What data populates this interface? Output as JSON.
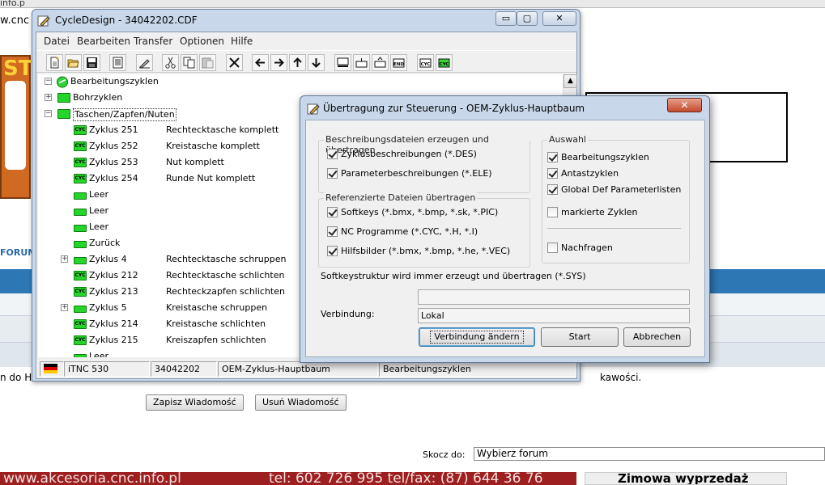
{
  "browser": {
    "url_fragment": "w.cnc",
    "tab_fragment": "info.p",
    "forum_label": "FORUM",
    "text_left": "n do H",
    "text_right": "kawości.",
    "save_button": "Zapisz Wiadomość",
    "delete_button": "Usuń Wiadomość",
    "jump_label": "Skocz do:",
    "jump_select": "Wybierz forum",
    "ad_left": "www.akcesoria.cnc.info.pl",
    "ad_phone": "tel: 602 726 995 tel/fax: (87) 644 36 76",
    "ad_right": "Zimowa wyprzedaż",
    "logo_text": "ST"
  },
  "window": {
    "title": "CycleDesign - 34042202.CDF",
    "minimize": "▭",
    "maximize": "▢",
    "close": "✕"
  },
  "menu": [
    "Datei",
    "Bearbeiten",
    "Transfer",
    "Optionen",
    "Hilfe"
  ],
  "toolbar": {
    "icons": [
      "new-file-icon",
      "open-folder-icon",
      "save-icon",
      "list-icon",
      "edit-pen-icon",
      "cut-icon",
      "copy-icon",
      "paste-icon",
      "delete-x-icon",
      "arrow-left-icon",
      "arrow-right-icon",
      "arrow-up-icon",
      "arrow-down-icon",
      "screen-icon",
      "softkey-icon",
      "softkey-up-icon",
      "end-icon",
      "cyc-icon",
      "cyc-green-icon"
    ],
    "end_label": "END",
    "cyc_label": "CYC"
  },
  "tree": {
    "root": "Bearbeitungszyklen",
    "items": [
      {
        "label": "Bohrzyklen",
        "desc": "",
        "level": 1,
        "expander": "+",
        "icon": "folder"
      },
      {
        "label": "Taschen/Zapfen/Nuten",
        "desc": "",
        "level": 1,
        "expander": "−",
        "icon": "folder"
      },
      {
        "label": "Zyklus 251",
        "desc": "Rechtecktasche komplett",
        "level": 2,
        "expander": "",
        "icon": "cyc"
      },
      {
        "label": "Zyklus 252",
        "desc": "Kreistasche komplett",
        "level": 2,
        "expander": "",
        "icon": "cyc"
      },
      {
        "label": "Zyklus 253",
        "desc": "Nut komplett",
        "level": 2,
        "expander": "",
        "icon": "cyc"
      },
      {
        "label": "Zyklus 254",
        "desc": "Runde Nut komplett",
        "level": 2,
        "expander": "",
        "icon": "cyc"
      },
      {
        "label": "Leer",
        "desc": "",
        "level": 2,
        "expander": "",
        "icon": "empty"
      },
      {
        "label": "Leer",
        "desc": "",
        "level": 2,
        "expander": "",
        "icon": "empty"
      },
      {
        "label": "Leer",
        "desc": "",
        "level": 2,
        "expander": "",
        "icon": "empty"
      },
      {
        "label": "Zurück",
        "desc": "",
        "level": 2,
        "expander": "",
        "icon": "back"
      },
      {
        "label": "Zyklus 4",
        "desc": "Rechtecktasche schruppen",
        "level": 2,
        "expander": "+",
        "icon": "empty"
      },
      {
        "label": "Zyklus 212",
        "desc": "Rechtecktasche schlichten",
        "level": 2,
        "expander": "",
        "icon": "cyc"
      },
      {
        "label": "Zyklus 213",
        "desc": "Rechteckzapfen schlichten",
        "level": 2,
        "expander": "",
        "icon": "cyc"
      },
      {
        "label": "Zyklus 5",
        "desc": "Kreistasche schruppen",
        "level": 2,
        "expander": "+",
        "icon": "empty"
      },
      {
        "label": "Zyklus 214",
        "desc": "Kreistasche schlichten",
        "level": 2,
        "expander": "",
        "icon": "cyc"
      },
      {
        "label": "Zyklus 215",
        "desc": "Kreiszapfen schlichten",
        "level": 2,
        "expander": "",
        "icon": "cyc"
      },
      {
        "label": "Leer",
        "desc": "",
        "level": 2,
        "expander": "",
        "icon": "empty"
      }
    ],
    "cyc_badge": "CYC"
  },
  "status": {
    "control": "iTNC 530",
    "file": "34042202",
    "tree": "OEM-Zyklus-Hauptbaum",
    "branch": "Bearbeitungszyklen"
  },
  "dialog": {
    "title": "Übertragung zur Steuerung - OEM-Zyklus-Hauptbaum",
    "close": "✕",
    "group_desc": {
      "label": "Beschreibungsdateien erzeugen und übertragen",
      "items": [
        {
          "label": "Zyklusbeschreibungen (*.DES)",
          "checked": true
        },
        {
          "label": "Parameterbeschreibungen (*.ELE)",
          "checked": true
        }
      ]
    },
    "group_ref": {
      "label": "Referenzierte Dateien übertragen",
      "items": [
        {
          "label": "Softkeys (*.bmx, *.bmp, *.sk, *.PIC)",
          "checked": true
        },
        {
          "label": "NC Programme (*.CYC, *.H, *.I)",
          "checked": true
        },
        {
          "label": "Hilfsbilder (*.bmx, *.bmp, *.he, *.VEC)",
          "checked": true
        }
      ]
    },
    "group_sel": {
      "label": "Auswahl",
      "items": [
        {
          "label": "Bearbeitungszyklen",
          "checked": true
        },
        {
          "label": "Antastzyklen",
          "checked": true
        },
        {
          "label": "Global Def Parameterlisten",
          "checked": true
        },
        {
          "label": "markierte Zyklen",
          "checked": false
        }
      ],
      "ask": {
        "label": "Nachfragen",
        "checked": false
      }
    },
    "softkey_note": "Softkeystruktur wird immer erzeugt und übertragen (*.SYS)",
    "connection_label": "Verbindung:",
    "connection_value": "Lokal",
    "btn_change": "Verbindung ändern",
    "btn_start": "Start",
    "btn_cancel": "Abbrechen"
  }
}
